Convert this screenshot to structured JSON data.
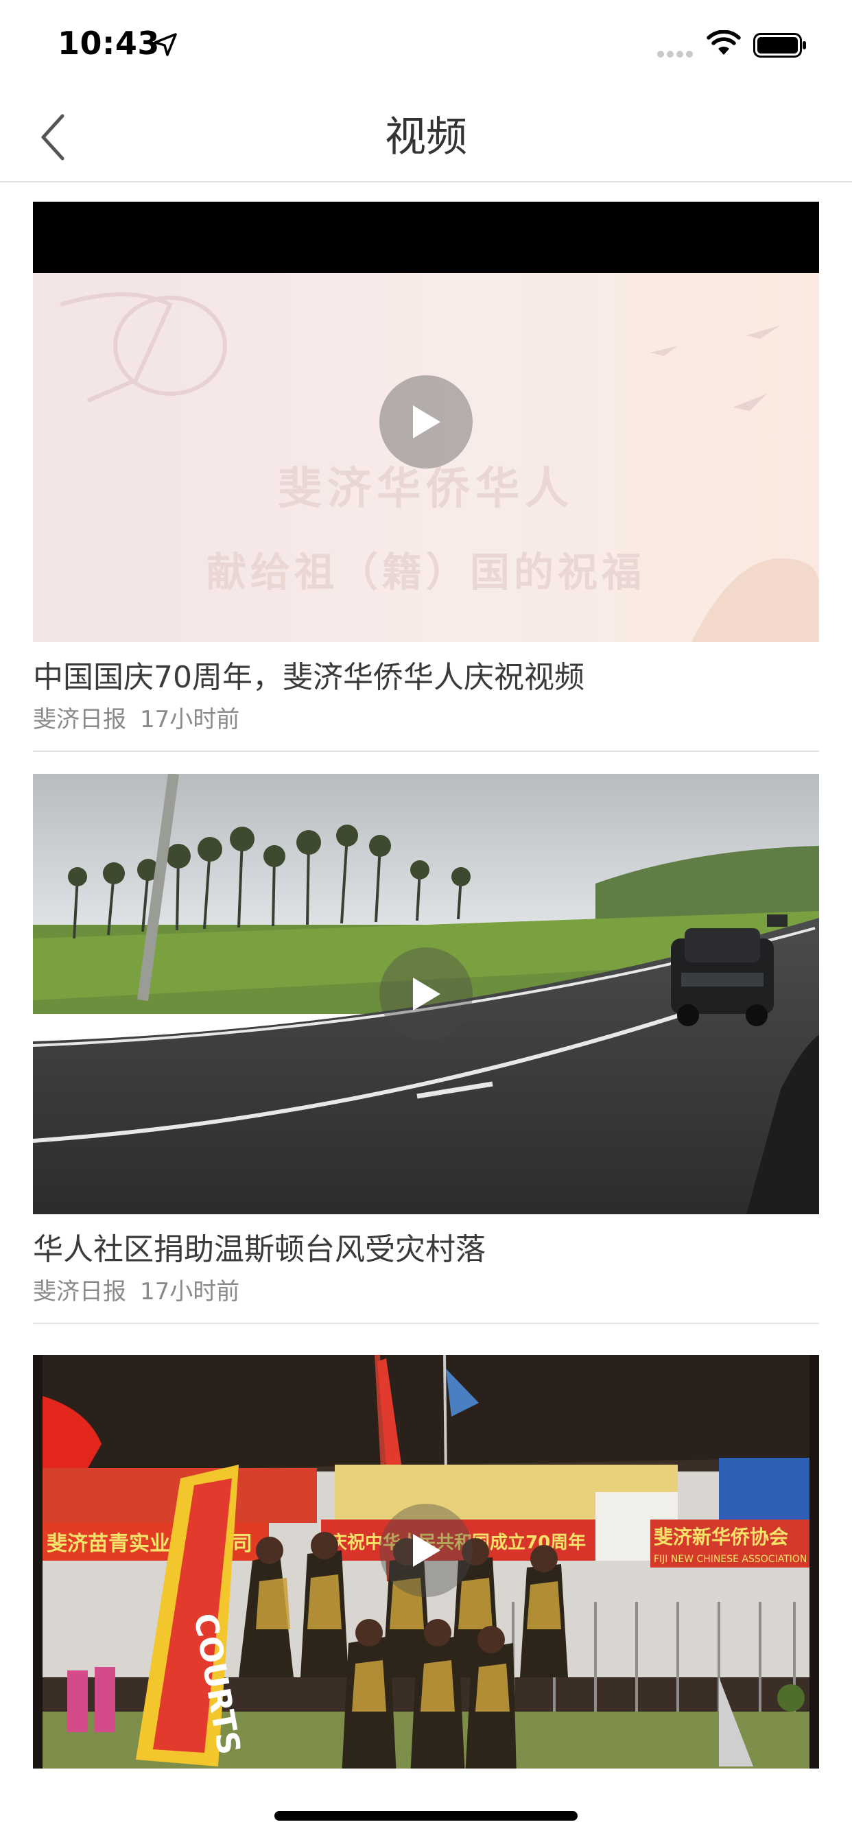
{
  "status_bar": {
    "time": "10:43"
  },
  "nav": {
    "title": "视频"
  },
  "videos": [
    {
      "title": "中国国庆70周年，斐济华侨华人庆祝视频",
      "source": "斐济日报",
      "time": "17小时前",
      "thumbnail_text_line1": "斐济华侨华人",
      "thumbnail_text_line2": "献给祖（籍）国的祝福"
    },
    {
      "title": "华人社区捐助温斯顿台风受灾村落",
      "source": "斐济日报",
      "time": "17小时前"
    },
    {
      "banner_text_left": "斐济苗青实业有限公司",
      "banner_text_mid": "庆祝中华人民共和国成立70周年",
      "banner_text_right": "斐济新华侨协会",
      "banner_text_right_en": "FIJI NEW CHINESE ASSOCIATION",
      "sign_text": "COURTS"
    }
  ]
}
